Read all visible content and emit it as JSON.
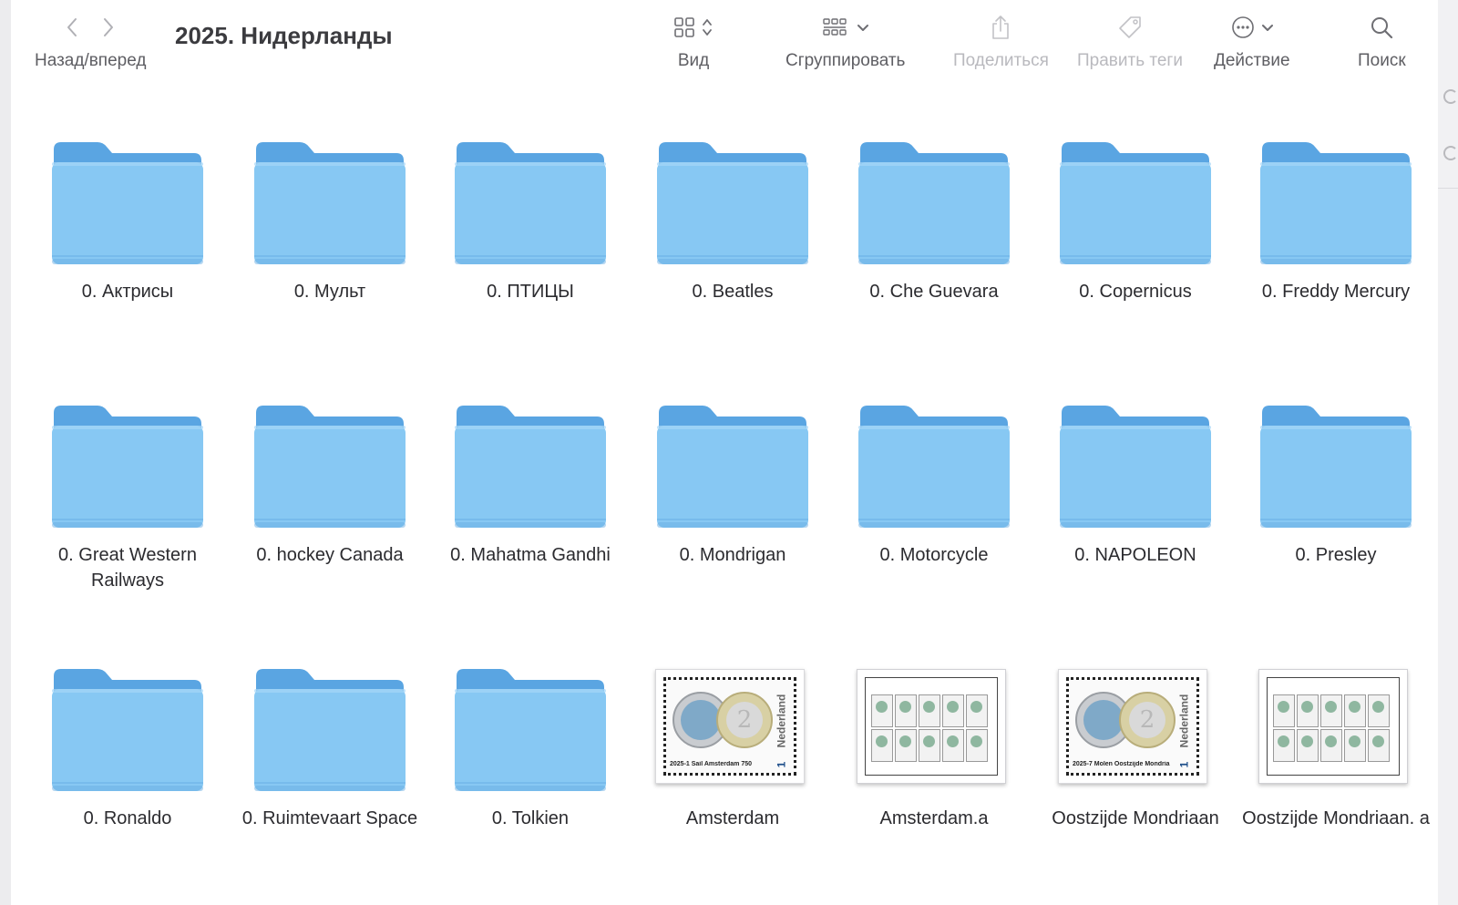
{
  "toolbar": {
    "nav_label": "Назад/вперед",
    "title": "2025. Нидерланды",
    "view_label": "Вид",
    "group_label": "Сгруппировать",
    "share_label": "Поделиться",
    "tags_label": "Править теги",
    "action_label": "Действие",
    "search_label": "Поиск"
  },
  "items": [
    {
      "name": "0. Актрисы",
      "kind": "folder"
    },
    {
      "name": "0. Мульт",
      "kind": "folder"
    },
    {
      "name": "0. ПТИЦЫ",
      "kind": "folder"
    },
    {
      "name": "0. Beatles",
      "kind": "folder"
    },
    {
      "name": "0. Che Guevara",
      "kind": "folder"
    },
    {
      "name": "0. Copernicus",
      "kind": "folder"
    },
    {
      "name": "0. Freddy Mercury",
      "kind": "folder"
    },
    {
      "name": "0. Great Western Railways",
      "kind": "folder"
    },
    {
      "name": "0. hockey Canada",
      "kind": "folder"
    },
    {
      "name": "0. Mahatma Gandhi",
      "kind": "folder"
    },
    {
      "name": "0. Mondrigan",
      "kind": "folder"
    },
    {
      "name": "0. Motorcycle",
      "kind": "folder"
    },
    {
      "name": "0. NAPOLEON",
      "kind": "folder"
    },
    {
      "name": "0. Presley",
      "kind": "folder"
    },
    {
      "name": "0. Ronaldo",
      "kind": "folder"
    },
    {
      "name": "0. Ruimtevaart Space",
      "kind": "folder"
    },
    {
      "name": "0. Tolkien",
      "kind": "folder"
    },
    {
      "name": "Amsterdam",
      "kind": "stamp",
      "stamp_text": "2025-1 Sail Amsterdam 750",
      "country": "Nederland",
      "value": "1"
    },
    {
      "name": "Amsterdam.a",
      "kind": "sheet"
    },
    {
      "name": "Oostzijde Mondriaan",
      "kind": "stamp",
      "stamp_text": "2025-7 Molen Oostzijde Mondria",
      "country": "Nederland",
      "value": "1"
    },
    {
      "name": "Oostzijde Mondriaan. a",
      "kind": "sheet"
    }
  ],
  "colors": {
    "folder_back": "#5aa5e2",
    "folder_front": "#87c8f3",
    "accent": "#1d8cf8"
  }
}
